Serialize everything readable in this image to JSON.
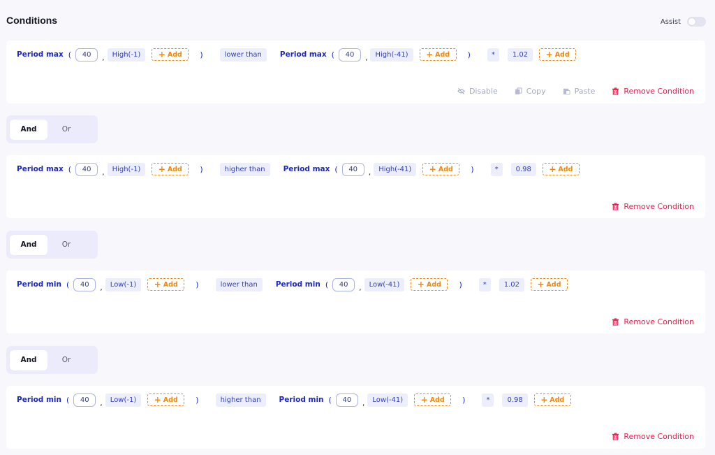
{
  "header": {
    "title": "Conditions",
    "assist_label": "Assist",
    "assist_on": false
  },
  "logic_labels": {
    "and": "And",
    "or": "Or"
  },
  "actions": {
    "disable": "Disable",
    "copy": "Copy",
    "paste": "Paste",
    "remove": "Remove Condition"
  },
  "add_label": "Add",
  "conditions": [
    {
      "left": {
        "func": "Period max",
        "period": "40",
        "source": "High(-1)"
      },
      "comparator": "lower than",
      "right": {
        "func": "Period max",
        "period": "40",
        "source": "High(-41)"
      },
      "operator": "*",
      "multiplier": "1.02"
    },
    {
      "left": {
        "func": "Period max",
        "period": "40",
        "source": "High(-1)"
      },
      "comparator": "higher than",
      "right": {
        "func": "Period max",
        "period": "40",
        "source": "High(-41)"
      },
      "operator": "*",
      "multiplier": "0.98"
    },
    {
      "left": {
        "func": "Period min",
        "period": "40",
        "source": "Low(-1)"
      },
      "comparator": "lower than",
      "right": {
        "func": "Period min",
        "period": "40",
        "source": "Low(-41)"
      },
      "operator": "*",
      "multiplier": "1.02"
    },
    {
      "left": {
        "func": "Period min",
        "period": "40",
        "source": "Low(-1)"
      },
      "comparator": "higher than",
      "right": {
        "func": "Period min",
        "period": "40",
        "source": "Low(-41)"
      },
      "operator": "*",
      "multiplier": "0.98"
    }
  ],
  "connectors": [
    "And",
    "And",
    "And"
  ],
  "colors": {
    "accent": "#1d28c8",
    "add_border": "#f08a12",
    "remove": "#dd2450",
    "muted_action": "#a6aabe"
  }
}
